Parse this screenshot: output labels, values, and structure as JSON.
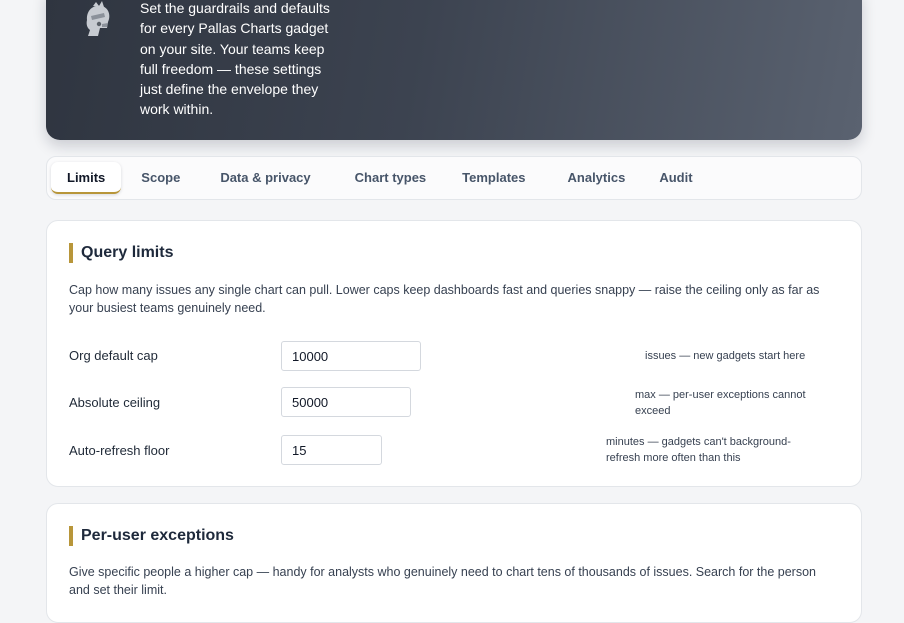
{
  "hero": {
    "description": "Set the guardrails and defaults for every Pallas Charts gadget on your site. Your teams keep full freedom — these settings just define the envelope they work within."
  },
  "tabs": [
    {
      "label": "Limits",
      "active": true
    },
    {
      "label": "Scope"
    },
    {
      "label": "Data & privacy"
    },
    {
      "label": "Chart types"
    },
    {
      "label": "Templates"
    },
    {
      "label": "Analytics"
    },
    {
      "label": "Audit"
    }
  ],
  "query_limits": {
    "title": "Query limits",
    "description": "Cap how many issues any single chart can pull. Lower caps keep dashboards fast and queries snappy — raise the ceiling only as far as your busiest teams genuinely need.",
    "rows": [
      {
        "label": "Org default cap",
        "value": "10000",
        "hint": "issues — new gadgets start here"
      },
      {
        "label": "Absolute ceiling",
        "value": "50000",
        "hint": "max — per-user exceptions cannot exceed"
      },
      {
        "label": "Auto-refresh floor",
        "value": "15",
        "hint": "minutes — gadgets can't background-refresh more often than this"
      }
    ]
  },
  "per_user_exceptions": {
    "title": "Per-user exceptions",
    "description": "Give specific people a higher cap — handy for analysts who genuinely need to chart tens of thousands of issues. Search for the person and set their limit."
  },
  "colors": {
    "accent": "#b8963a",
    "hero_dark": "#2f3540",
    "hero_light": "#5a6270"
  },
  "icons": {
    "brand": "pallas-helmet-icon"
  }
}
